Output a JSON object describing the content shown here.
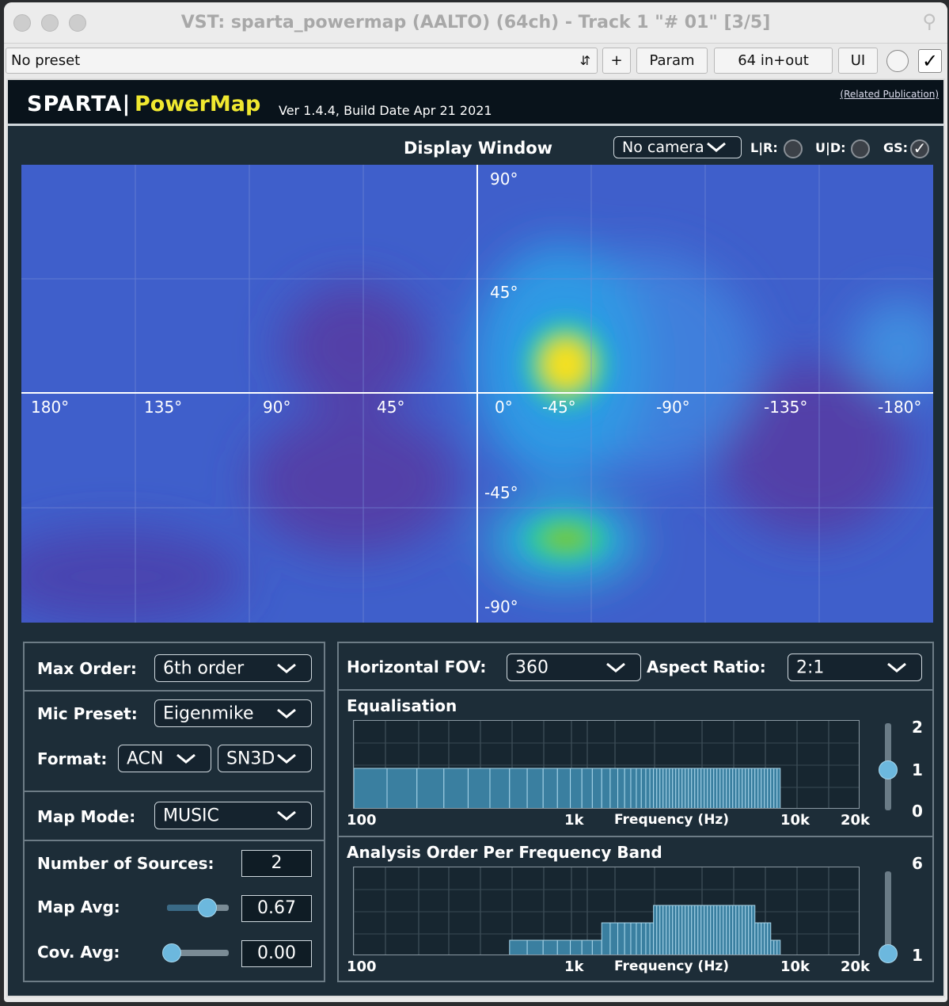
{
  "window": {
    "title": "VST: sparta_powermap (AALTO) (64ch) - Track 1 \"# 01\" [3/5]"
  },
  "toolbar": {
    "preset": "No preset",
    "plus": "+",
    "param": "Param",
    "io": "64 in+out",
    "ui": "UI"
  },
  "header": {
    "brand": "SPARTA|",
    "product": "PowerMap",
    "version": "Ver 1.4.4, Build Date Apr 21 2021",
    "related": "(Related Publication)"
  },
  "display": {
    "title": "Display Window",
    "camera": "No camera",
    "lr_label": "L|R:",
    "ud_label": "U|D:",
    "gs_label": "GS:",
    "az_labels": [
      "180°",
      "135°",
      "90°",
      "45°",
      "0°",
      "-45°",
      "-90°",
      "-135°",
      "-180°"
    ],
    "el_labels": [
      "90°",
      "45°",
      "-45°",
      "-90°"
    ]
  },
  "left": {
    "max_order_label": "Max Order:",
    "max_order": "6th order",
    "mic_label": "Mic Preset:",
    "mic": "Eigenmike",
    "format_label": "Format:",
    "channel_order": "ACN",
    "norm": "SN3D",
    "mapmode_label": "Map Mode:",
    "mapmode": "MUSIC",
    "nsrc_label": "Number of Sources:",
    "nsrc": "2",
    "mapavg_label": "Map Avg:",
    "mapavg": "0.67",
    "covavg_label": "Cov. Avg:",
    "covavg": "0.00"
  },
  "right": {
    "hfov_label": "Horizontal FOV:",
    "hfov": "360",
    "aspect_label": "Aspect Ratio:",
    "aspect": "2:1",
    "eq_title": "Equalisation",
    "eq_ticks": [
      "100",
      "1k",
      "Frequency (Hz)",
      "10k",
      "20k"
    ],
    "eq_scale": [
      "2",
      "1",
      "0"
    ],
    "ao_title": "Analysis Order Per Frequency Band",
    "ao_ticks": [
      "100",
      "1k",
      "Frequency (Hz)",
      "10k",
      "20k"
    ],
    "ao_scale": [
      "6",
      "1"
    ]
  },
  "colors": {
    "bg": "#1d2d38",
    "accent": "#6cb8de",
    "brand_yellow": "#f0e830"
  }
}
